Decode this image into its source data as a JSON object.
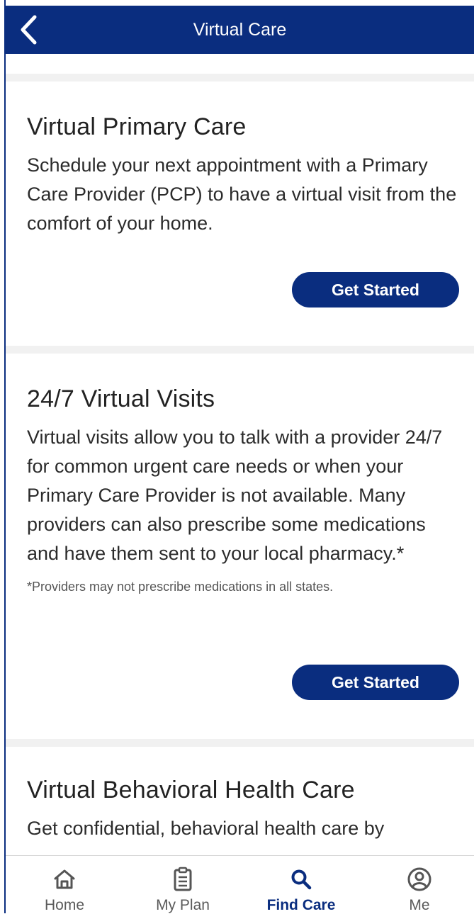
{
  "header": {
    "title": "Virtual Care",
    "back_icon": "chevron-left-icon"
  },
  "cards": [
    {
      "title": "Virtual Primary Care",
      "body": "Schedule your next appointment with a Primary Care Provider (PCP) to have a virtual visit from the comfort of your home.",
      "button": "Get Started"
    },
    {
      "title": "24/7 Virtual Visits",
      "body": "Virtual visits allow you to talk with a provider 24/7 for common urgent care needs or when your Primary Care Provider is not available. Many providers can also prescribe some medications and have them sent to your local pharmacy.*",
      "note": "*Providers may not prescribe medications in all states.",
      "button": "Get Started"
    },
    {
      "title": "Virtual Behavioral Health Care",
      "body": "Get confidential, behavioral health care by"
    }
  ],
  "tabbar": {
    "tabs": [
      {
        "label": "Home",
        "icon": "home-icon",
        "active": false
      },
      {
        "label": "My Plan",
        "icon": "clipboard-icon",
        "active": false
      },
      {
        "label": "Find Care",
        "icon": "search-icon",
        "active": true
      },
      {
        "label": "Me",
        "icon": "profile-icon",
        "active": false
      }
    ]
  },
  "colors": {
    "brand": "#0a2d7f",
    "separator": "#f1f1f1",
    "inactive_tab": "#5a5a5a"
  }
}
